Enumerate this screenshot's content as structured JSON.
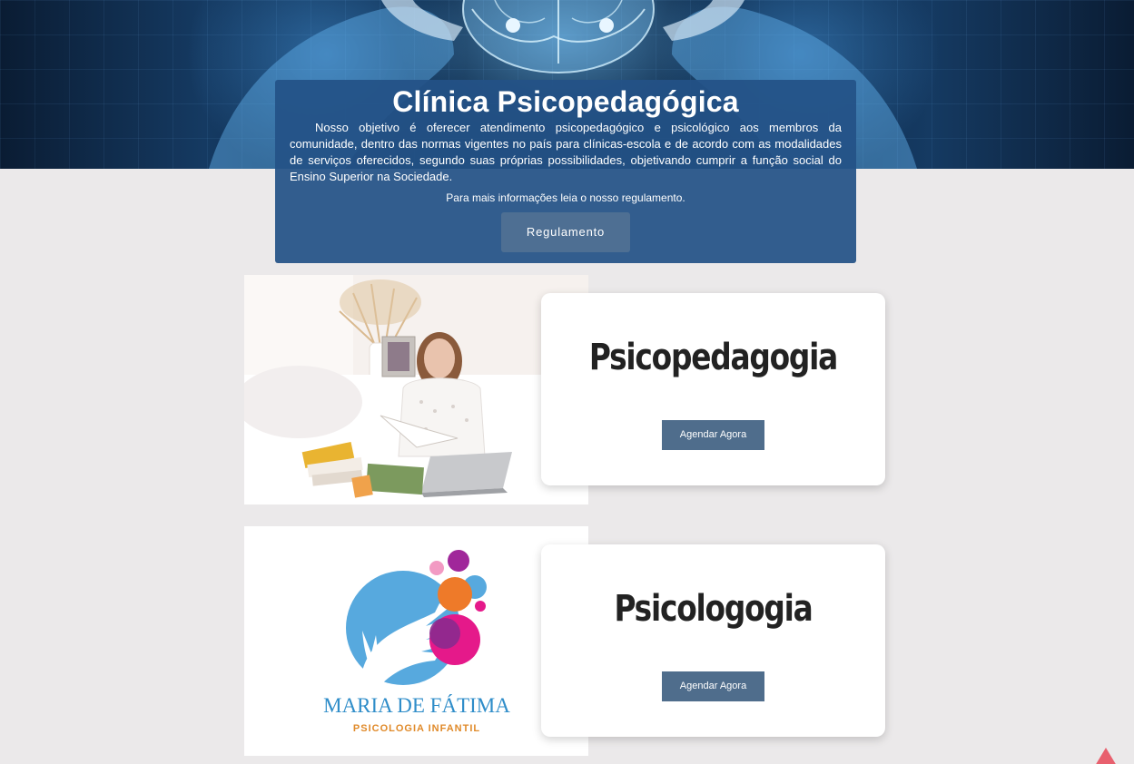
{
  "hero": {
    "image": "brain-in-hands-banner"
  },
  "info": {
    "title": "Clínica Psicopedagógica",
    "text": "Nosso objetivo é oferecer atendimento psicopedagógico e psicológico aos membros da comunidade, dentro das normas vigentes no país para clínicas-escola e de acordo com as modalidades de serviços oferecidos, segundo suas próprias possibilidades, objetivando cumprir a função social do Ensino Superior na Sociedade.",
    "more": "Para mais informações leia o nosso regulamento.",
    "button_label": "Regulamento"
  },
  "services": [
    {
      "title": "Psicopedagogia",
      "button_label": "Agendar Agora",
      "image": "woman-reading-books-photo"
    },
    {
      "title": "Psicologogia",
      "button_label": "Agendar Agora",
      "image": "maria-de-fatima-logo",
      "logo_name": "MARIA DE FÁTIMA",
      "logo_subtitle": "PSICOLOGIA INFANTIL"
    }
  ],
  "colors": {
    "panel_bg": "#245286",
    "button_bg": "#4f6d8c",
    "page_bg": "#ebe9ea",
    "scroll_top": "#e8606e"
  },
  "scroll_top_icon": "arrow-up-icon"
}
